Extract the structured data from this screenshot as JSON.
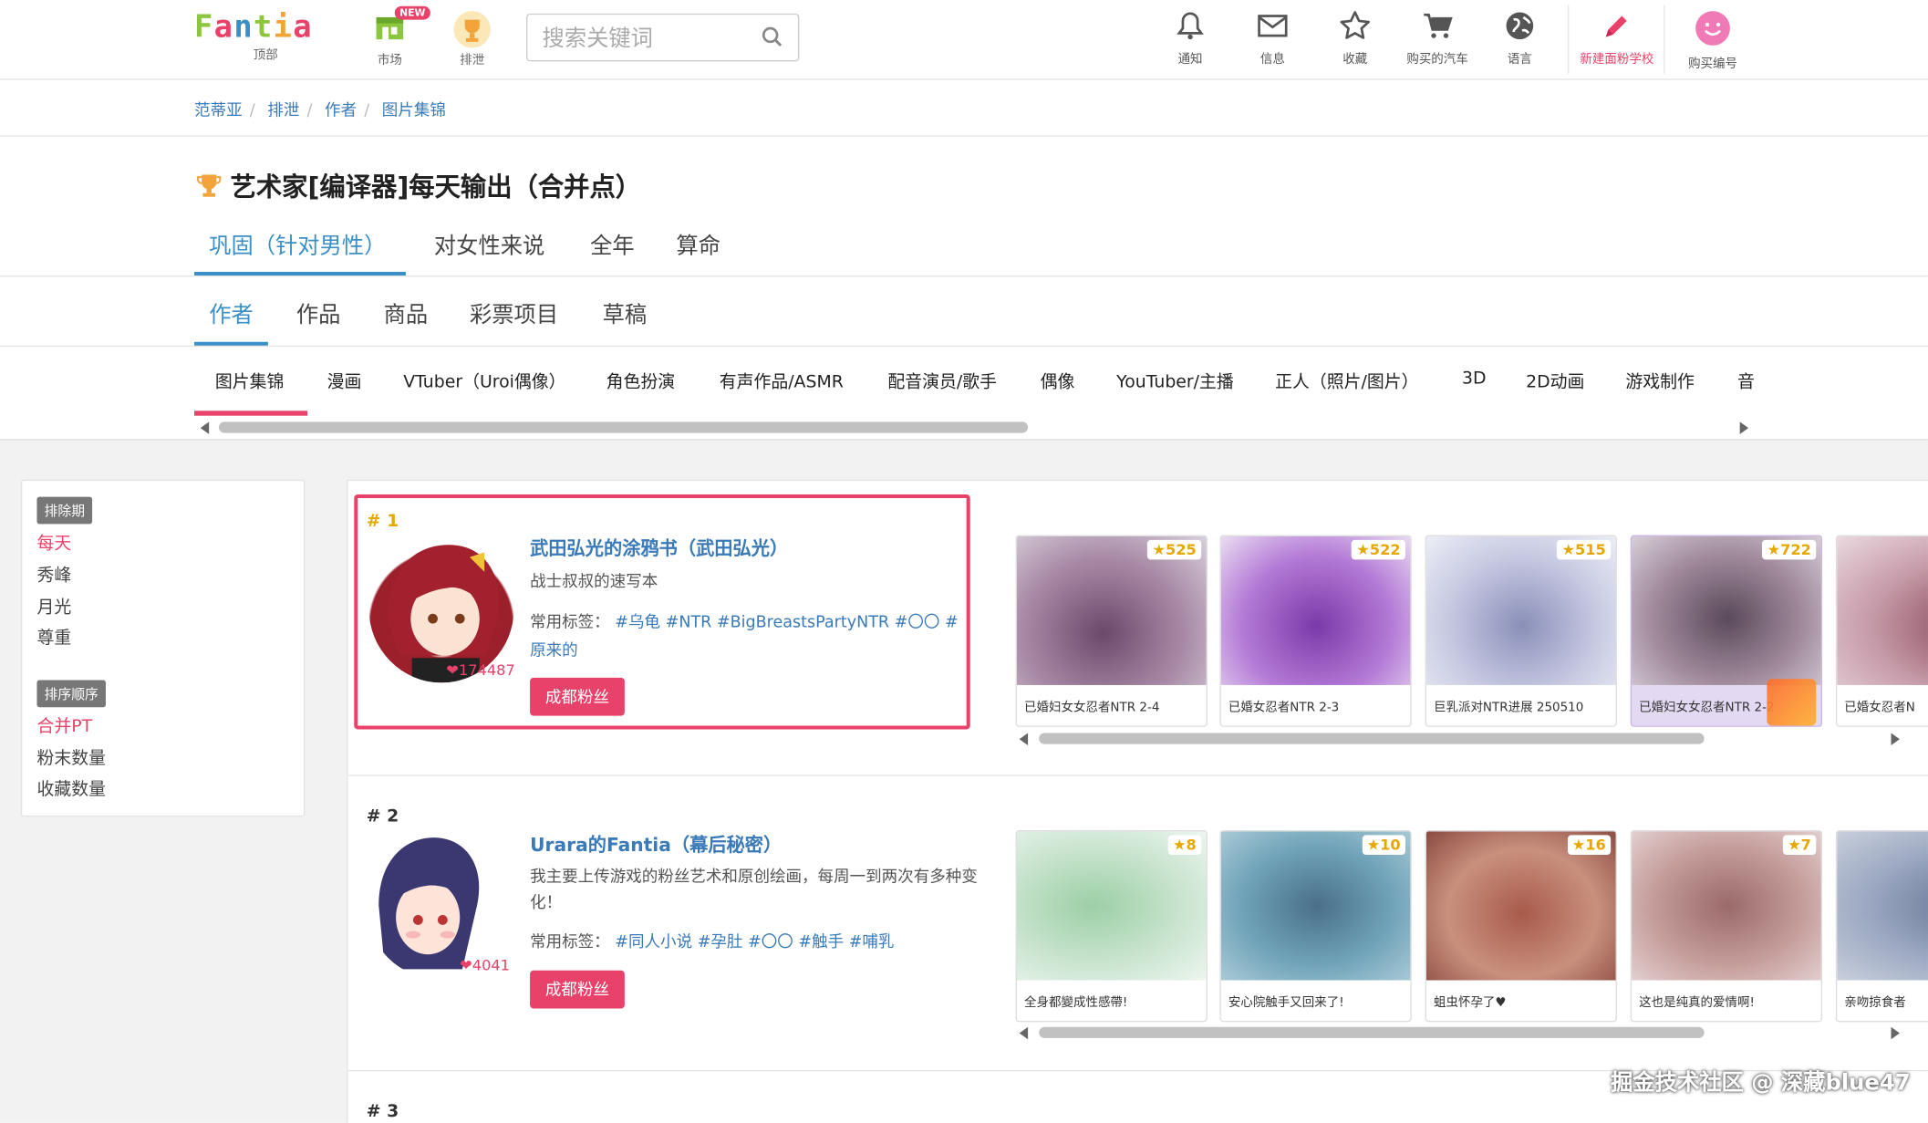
{
  "header": {
    "logo_text": "Fantia",
    "nav": [
      {
        "label": "顶部",
        "icon": "logo-icon"
      },
      {
        "label": "市场",
        "icon": "market-icon",
        "badge": "NEW"
      },
      {
        "label": "排泄",
        "icon": "trophy-icon"
      }
    ],
    "search_placeholder": "搜索关键词",
    "right_nav": [
      {
        "label": "通知",
        "icon": "bell-icon"
      },
      {
        "label": "信息",
        "icon": "mail-icon"
      },
      {
        "label": "收藏",
        "icon": "star-icon"
      },
      {
        "label": "购买的汽车",
        "icon": "cart-icon"
      },
      {
        "label": "语言",
        "icon": "globe-icon"
      },
      {
        "label": "新建面粉学校",
        "icon": "pen-icon"
      },
      {
        "label": "购买编号",
        "icon": "smile-icon"
      }
    ]
  },
  "breadcrumb": [
    "范蒂亚",
    "排泄",
    "作者",
    "图片集锦"
  ],
  "page_title": "艺术家[编译器]每天输出（合并点）",
  "tabs_gender": [
    "巩固（针对男性）",
    "对女性来说",
    "全年",
    "算命"
  ],
  "tabs_type": [
    "作者",
    "作品",
    "商品",
    "彩票项目",
    "草稿"
  ],
  "tabs_category": [
    "图片集锦",
    "漫画",
    "VTuber（Uroi偶像）",
    "角色扮演",
    "有声作品/ASMR",
    "配音演员/歌手",
    "偶像",
    "YouTuber/主播",
    "正人（照片/图片）",
    "3D",
    "2D动画",
    "游戏制作",
    "音"
  ],
  "sidebar": {
    "period_label": "排除期",
    "periods": [
      "每天",
      "秀峰",
      "月光",
      "尊重"
    ],
    "order_label": "排序顺序",
    "orders": [
      "合并PT",
      "粉末数量",
      "收藏数量"
    ]
  },
  "ranking": [
    {
      "rank": "# 1",
      "name": "武田弘光的涂鸦书（武田弘光）",
      "desc": "战士叔叔的速写本",
      "tags_label": "常用标签：",
      "tags": [
        "#乌龟",
        "#NTR",
        "#BigBreastsPartyNTR",
        "#〇〇",
        "#原来的"
      ],
      "fans": "174487",
      "button": "成都粉丝",
      "works": [
        {
          "stars": "525",
          "caption": "已婚妇女女忍者NTR 2-4"
        },
        {
          "stars": "522",
          "caption": "已婚女忍者NTR 2-3"
        },
        {
          "stars": "515",
          "caption": "巨乳派对NTR进展 250510"
        },
        {
          "stars": "722",
          "caption": "已婚妇女女忍者NTR 2-2"
        },
        {
          "stars": "",
          "caption": "已婚女忍者N"
        }
      ]
    },
    {
      "rank": "# 2",
      "name": "Urara的Fantia（幕后秘密）",
      "desc": "我主要上传游戏的粉丝艺术和原创绘画，每周一到两次有多种变化！",
      "tags_label": "常用标签：",
      "tags": [
        "#同人小说",
        "#孕肚",
        "#〇〇",
        "#触手",
        "#哺乳"
      ],
      "fans": "4041",
      "button": "成都粉丝",
      "works": [
        {
          "stars": "8",
          "caption": "全身都變成性感帶!"
        },
        {
          "stars": "10",
          "caption": "安心院触手又回来了!"
        },
        {
          "stars": "16",
          "caption": "蛆虫怀孕了♥"
        },
        {
          "stars": "7",
          "caption": "这也是纯真的爱情啊!"
        },
        {
          "stars": "",
          "caption": "亲吻掠食者"
        }
      ]
    },
    {
      "rank": "# 3"
    }
  ],
  "watermark": "掘金技术社区 @ 深藏blue47",
  "colors": {
    "accent_blue": "#3a8fc7",
    "accent_pink": "#e9426a"
  }
}
